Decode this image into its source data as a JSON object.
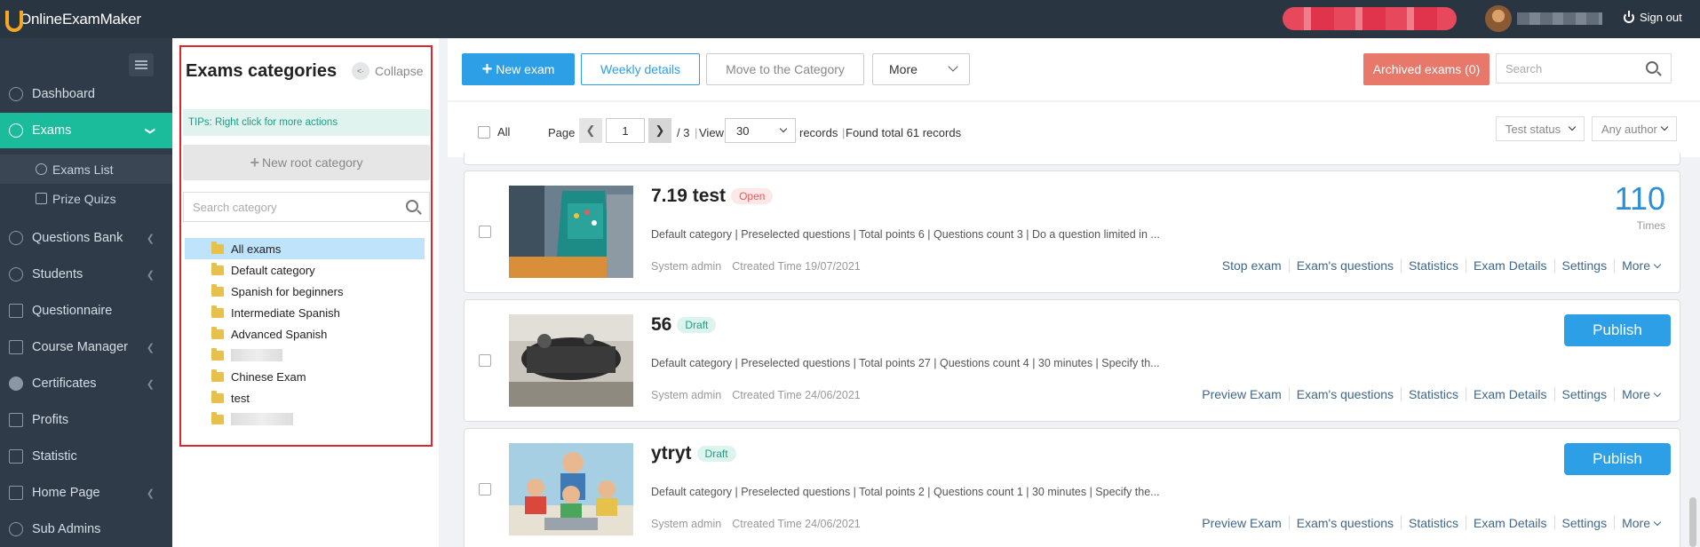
{
  "header": {
    "logo_text": "OnlineExamMaker",
    "signout_label": "Sign out"
  },
  "sidebar": {
    "items": [
      {
        "label": "Dashboard"
      },
      {
        "label": "Exams"
      },
      {
        "label": "Questions Bank"
      },
      {
        "label": "Students"
      },
      {
        "label": "Questionnaire"
      },
      {
        "label": "Course Manager"
      },
      {
        "label": "Certificates"
      },
      {
        "label": "Profits"
      },
      {
        "label": "Statistic"
      },
      {
        "label": "Home Page"
      },
      {
        "label": "Sub Admins"
      }
    ],
    "sub_items": [
      {
        "label": "Exams List"
      },
      {
        "label": "Prize Quizs"
      }
    ]
  },
  "categories": {
    "title": "Exams categories",
    "collapse_label": "Collapse",
    "tips": "TIPs:  Right click for more actions",
    "new_root_label": "New root category",
    "search_placeholder": "Search category",
    "tree": [
      {
        "label": "All exams"
      },
      {
        "label": "Default category"
      },
      {
        "label": "Spanish for beginners"
      },
      {
        "label": "Intermediate Spanish"
      },
      {
        "label": "Advanced Spanish"
      },
      {
        "label": ""
      },
      {
        "label": "Chinese Exam"
      },
      {
        "label": "test"
      },
      {
        "label": ""
      }
    ]
  },
  "toolbar": {
    "new_exam": "New exam",
    "weekly_details": "Weekly details",
    "move_category": "Move to the Category",
    "more": "More",
    "archived": "Archived exams (0)",
    "search_placeholder": "Search"
  },
  "pager": {
    "all_label": "All",
    "page_label": "Page",
    "current_page": "1",
    "total_pages": "/ 3",
    "view_label": "View",
    "per_page": "30",
    "records_label": "records",
    "found_label": "Found total 61 records",
    "filter_status": "Test status",
    "filter_author": "Any author"
  },
  "exams": [
    {
      "title": "7.19 test",
      "status": "Open",
      "description": "Default category | Preselected questions | Total points 6 | Questions count 3 | Do a question limited in ...",
      "author": "System admin",
      "created": "Ctreated Time 19/07/2021",
      "times": "110",
      "times_label": "Times",
      "actions": [
        "Stop exam",
        "Exam's questions",
        "Statistics",
        "Exam Details",
        "Settings",
        "More"
      ]
    },
    {
      "title": "56",
      "status": "Draft",
      "description": "Default category | Preselected questions | Total points 27 | Questions count 4 | 30 minutes | Specify th...",
      "author": "System admin",
      "created": "Ctreated Time 24/06/2021",
      "publish_label": "Publish",
      "actions": [
        "Preview Exam",
        "Exam's questions",
        "Statistics",
        "Exam Details",
        "Settings",
        "More"
      ]
    },
    {
      "title": "ytryt",
      "status": "Draft",
      "description": "Default category | Preselected questions | Total points 2 | Questions count 1 | 30 minutes | Specify the...",
      "author": "System admin",
      "created": "Ctreated Time 24/06/2021",
      "publish_label": "Publish",
      "actions": [
        "Preview Exam",
        "Exam's questions",
        "Statistics",
        "Exam Details",
        "Settings",
        "More"
      ]
    }
  ]
}
